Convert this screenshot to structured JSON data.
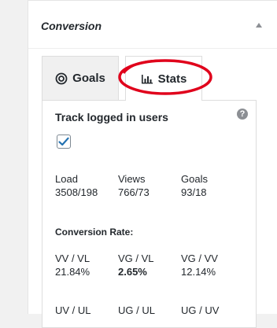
{
  "panel": {
    "title": "Conversion"
  },
  "tabs": [
    {
      "label": "Goals",
      "icon": "target-icon"
    },
    {
      "label": "Stats",
      "icon": "bar-chart-icon"
    }
  ],
  "stats": {
    "track_label": "Track logged in users",
    "track_checked": true,
    "help": "?",
    "row1": [
      {
        "label": "Load",
        "value": "3508/198"
      },
      {
        "label": "Views",
        "value": "766/73"
      },
      {
        "label": "Goals",
        "value": "93/18"
      }
    ],
    "conversion_title": "Conversion Rate:",
    "row2": [
      {
        "label": "VV / VL",
        "value": "21.84%"
      },
      {
        "label": "VG / VL",
        "value": "2.65%"
      },
      {
        "label": "VG / VV",
        "value": "12.14%"
      }
    ],
    "row3": [
      {
        "label": "UV / UL"
      },
      {
        "label": "UG / UL"
      },
      {
        "label": "UG / UV"
      }
    ]
  },
  "colors": {
    "annotation": "#e0001b",
    "check": "#2271b1"
  }
}
